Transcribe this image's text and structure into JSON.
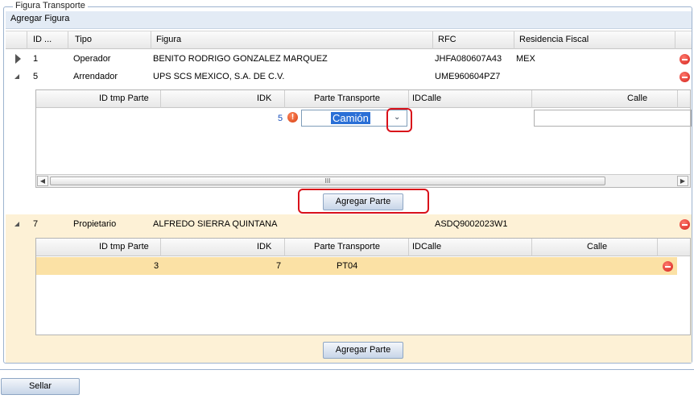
{
  "fieldset": {
    "legend": "Figura Transporte"
  },
  "toolbar": {
    "add_figure": "Agregar Figura"
  },
  "columns": {
    "id": "ID ...",
    "tipo": "Tipo",
    "figura": "Figura",
    "rfc": "RFC",
    "residencia": "Residencia Fiscal"
  },
  "rows": [
    {
      "id": "1",
      "tipo": "Operador",
      "figura": "BENITO RODRIGO GONZALEZ MARQUEZ",
      "rfc": "JHFA080607A43",
      "residencia": "MEX"
    },
    {
      "id": "5",
      "tipo": "Arrendador",
      "figura": "UPS SCS MEXICO, S.A. DE C.V.",
      "rfc": "UME960604PZ7",
      "residencia": ""
    },
    {
      "id": "7",
      "tipo": "Propietario",
      "figura": "ALFREDO SIERRA QUINTANA",
      "rfc": "ASDQ9002023W1",
      "residencia": ""
    }
  ],
  "sub_columns": {
    "id_tmp": "ID tmp Parte",
    "idk": "IDK",
    "parte": "Parte Transporte",
    "idcalle": "IDCalle",
    "calle": "Calle"
  },
  "sub1": {
    "idk": "5",
    "parte_value": "Camión",
    "scroll_grip": "III"
  },
  "sub2": {
    "id_tmp": "3",
    "idk": "7",
    "parte": "PT04"
  },
  "buttons": {
    "agregar_parte": "Agregar Parte",
    "sellar": "Sellar"
  },
  "colors": {
    "highlight_row": "#fdf1d6",
    "selected_row": "#fbe1a5",
    "alert": "#d9111a"
  }
}
